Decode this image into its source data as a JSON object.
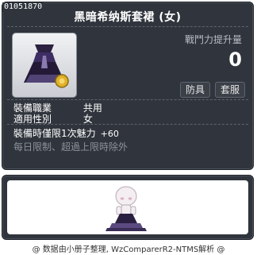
{
  "tooltip": {
    "item_id": "01051870",
    "title": "黑暗希纳斯套裙 (女)",
    "icon": "dress-item-icon",
    "power_label": "戰鬥力提升量",
    "power_value": "0",
    "tags": [
      "防具",
      "套服"
    ],
    "info": [
      {
        "key": "裝備職業",
        "value": "共用"
      },
      {
        "key": "適用性別",
        "value": "女"
      }
    ],
    "bonus_label": "裝備時僅限1次魅力",
    "bonus_value": "+60",
    "limit_text": "每日限制、超過上限時除外"
  },
  "preview": {
    "icon": "character-preview-icon"
  },
  "footer": {
    "text": "@ 数据由小册子整理, WzComparerR2-NTMS解析 @"
  },
  "colors": {
    "panel": "#30353d",
    "text": "#ffffff",
    "muted": "#8d9199"
  }
}
